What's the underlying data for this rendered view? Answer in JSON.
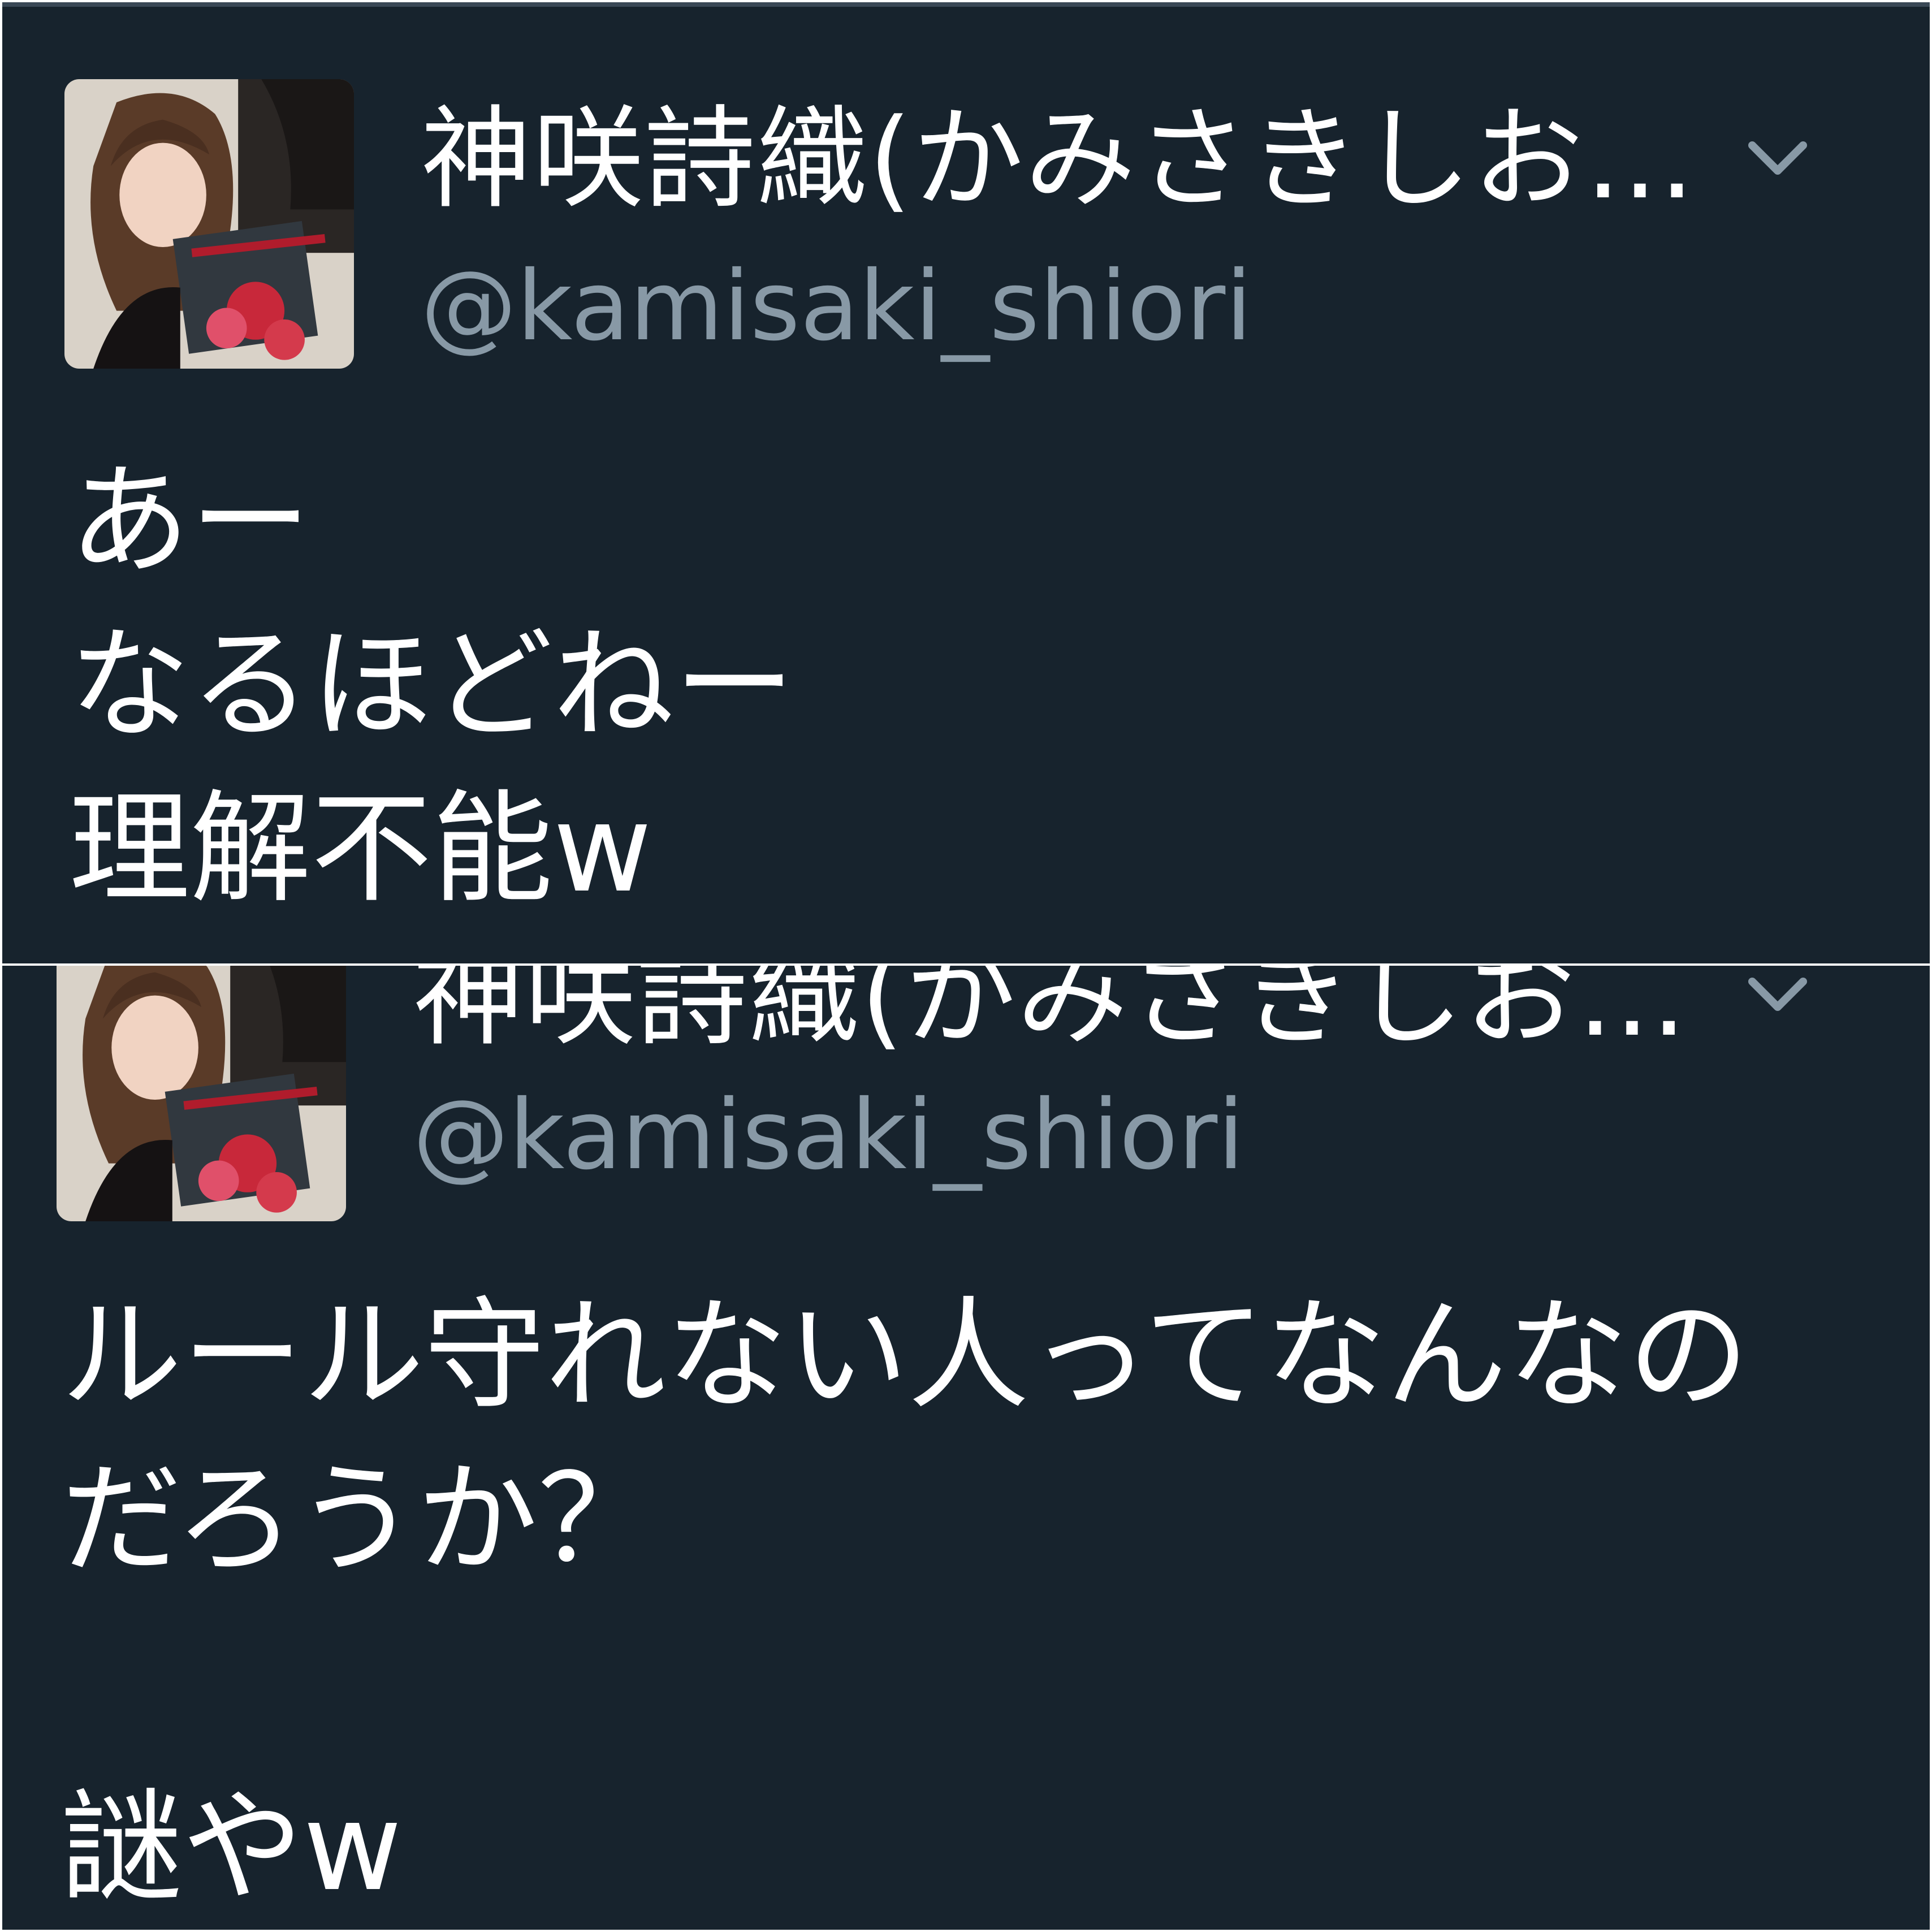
{
  "colors": {
    "background": "#17232d",
    "text": "#ffffff",
    "handle": "#8899a6",
    "chevron": "#8899a6"
  },
  "tweets": [
    {
      "display_name": "神咲詩織(かみさきしお…",
      "handle": "@kamisaki_shiori",
      "lines": [
        "あー",
        "なるほどねー",
        "理解不能w"
      ]
    },
    {
      "display_name": "神咲詩織(かみさきしお…",
      "handle": "@kamisaki_shiori",
      "lines": [
        "ルール守れない人ってなんなの",
        "だろうか？",
        "謎やw"
      ]
    }
  ]
}
